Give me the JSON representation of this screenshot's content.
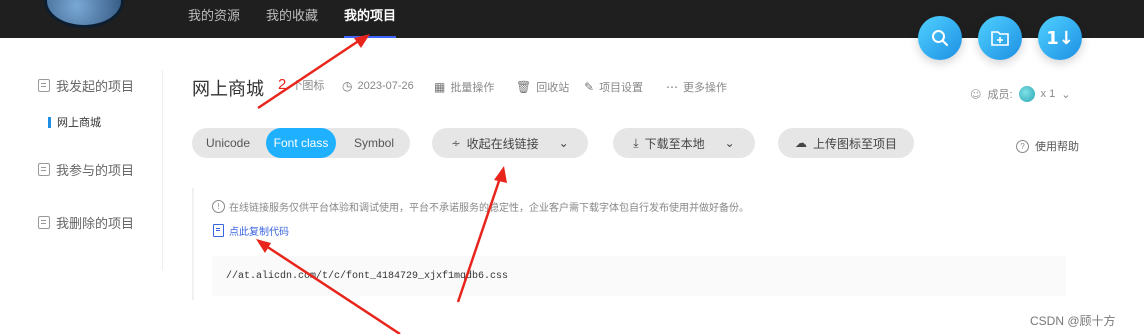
{
  "topnav": {
    "items": [
      {
        "label": "我的资源",
        "active": false
      },
      {
        "label": "我的收藏",
        "active": false
      },
      {
        "label": "我的项目",
        "active": true
      }
    ]
  },
  "fabs": {
    "search": "search-icon",
    "add_folder": "folder-plus-icon",
    "sort_label": "1↓"
  },
  "sidebar": {
    "items": [
      {
        "label": "我发起的项目"
      },
      {
        "label": "网上商城",
        "sub": true
      },
      {
        "label": "我参与的项目"
      },
      {
        "label": "我删除的项目"
      }
    ]
  },
  "project": {
    "title": "网上商城",
    "count_number": "2",
    "count_text": "个图标",
    "date": "2023-07-26",
    "batch": "批量操作",
    "recycle": "回收站",
    "settings": "项目设置",
    "more": "更多操作",
    "members_label": "成员:",
    "members_count": "x 1"
  },
  "format_tabs": {
    "options": [
      "Unicode",
      "Font class",
      "Symbol"
    ],
    "active": "Font class"
  },
  "actions": {
    "collapse_link": "收起在线链接",
    "download": "下载至本地",
    "upload": "上传图标至项目",
    "help": "使用帮助"
  },
  "notice": {
    "text": "在线链接服务仅供平台体验和调试使用，平台不承诺服务的稳定性，企业客户需下载字体包自行发布使用并做好备份。",
    "copy_code": "点此复制代码",
    "code": "//at.alicdn.com/t/c/font_4184729_xjxf1mqdb6.css"
  },
  "watermark": "CSDN @顾十方",
  "colors": {
    "topbar": "#1f1f1f",
    "accent": "#1fb0ff",
    "link": "#3a64e0",
    "annotation": "#e8251c"
  }
}
